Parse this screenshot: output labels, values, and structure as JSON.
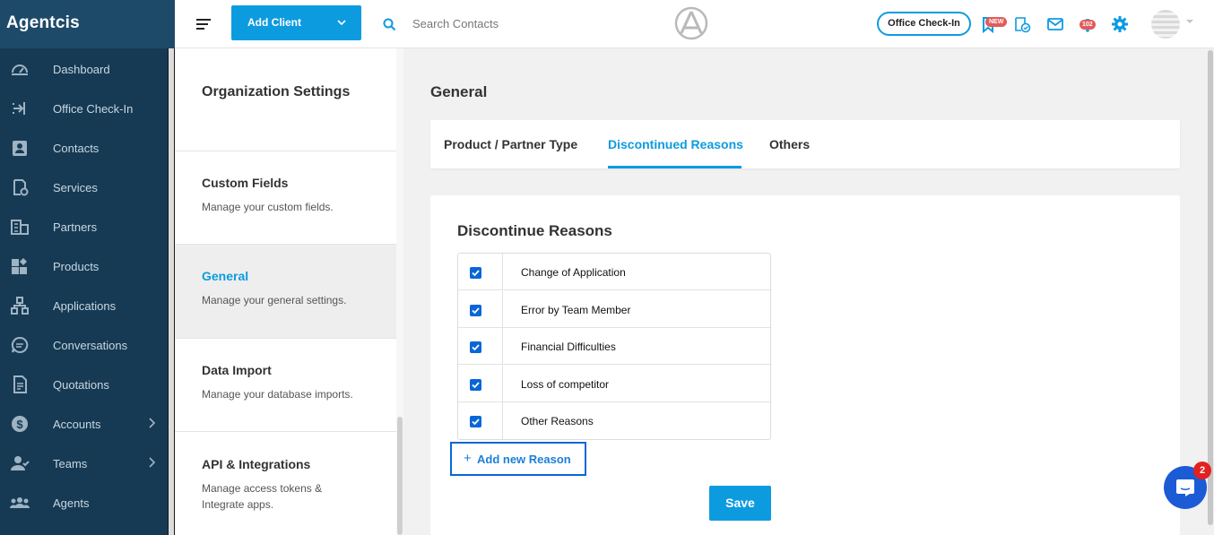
{
  "app": {
    "brand": "Agentcis"
  },
  "sidebar": {
    "items": [
      {
        "label": "Dashboard",
        "icon": "dashboard-icon"
      },
      {
        "label": "Office Check-In",
        "icon": "office-checkin-icon"
      },
      {
        "label": "Contacts",
        "icon": "contacts-icon"
      },
      {
        "label": "Services",
        "icon": "services-icon"
      },
      {
        "label": "Partners",
        "icon": "partners-icon"
      },
      {
        "label": "Products",
        "icon": "products-icon"
      },
      {
        "label": "Applications",
        "icon": "applications-icon"
      },
      {
        "label": "Conversations",
        "icon": "conversations-icon"
      },
      {
        "label": "Quotations",
        "icon": "quotations-icon"
      },
      {
        "label": "Accounts",
        "icon": "accounts-icon",
        "expandable": true
      },
      {
        "label": "Teams",
        "icon": "teams-icon",
        "expandable": true
      },
      {
        "label": "Agents",
        "icon": "agents-icon"
      }
    ]
  },
  "topbar": {
    "add_client_label": "Add Client",
    "search_placeholder": "Search Contacts",
    "office_checkin_label": "Office Check-In",
    "new_badge": "NEW",
    "notification_count": "102"
  },
  "settings": {
    "title": "Organization Settings",
    "items": [
      {
        "title": "Custom Fields",
        "desc": "Manage your custom fields."
      },
      {
        "title": "General",
        "desc": "Manage your general settings.",
        "active": true
      },
      {
        "title": "Data Import",
        "desc": "Manage your database imports."
      },
      {
        "title": "API & Integrations",
        "desc": "Manage access tokens & Integrate apps."
      }
    ]
  },
  "main": {
    "title": "General",
    "tabs": [
      {
        "label": "Product / Partner Type"
      },
      {
        "label": "Discontinued Reasons",
        "active": true
      },
      {
        "label": "Others"
      }
    ],
    "section_title": "Discontinue Reasons",
    "reasons": [
      {
        "label": "Change of Application",
        "checked": true
      },
      {
        "label": "Error by Team Member",
        "checked": true
      },
      {
        "label": "Financial Difficulties",
        "checked": true
      },
      {
        "label": "Loss of competitor",
        "checked": true
      },
      {
        "label": "Other Reasons",
        "checked": true
      }
    ],
    "add_reason_label": "Add new Reason",
    "save_label": "Save"
  },
  "chat": {
    "badge_count": "2"
  },
  "colors": {
    "accent": "#0d9be0",
    "sidebar_bg": "#163a54",
    "brand_bg": "#1e4a6a",
    "checkbox": "#0a66d8",
    "badge": "#e25b5b"
  }
}
